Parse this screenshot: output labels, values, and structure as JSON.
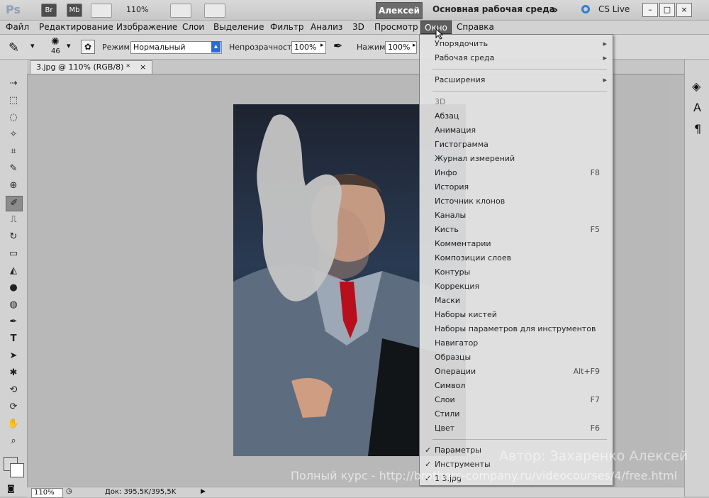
{
  "topbar": {
    "app_logo": "Ps",
    "br": "Br",
    "mb": "Mb",
    "zoom": "110%",
    "user": "Алексей",
    "workspace": "Основная рабочая среда",
    "cs_live": "CS Live"
  },
  "menubar": {
    "items": [
      "Файл",
      "Редактирование",
      "Изображение",
      "Слои",
      "Выделение",
      "Фильтр",
      "Анализ",
      "3D",
      "Просмотр",
      "Окно",
      "Справка"
    ]
  },
  "options": {
    "brush_size": "46",
    "mode_label": "Режим:",
    "mode_value": "Нормальный",
    "opacity_label": "Непрозрачность:",
    "opacity_value": "100%",
    "pressure_label": "Нажим:",
    "pressure_value": "100%"
  },
  "document": {
    "tab_title": "3.jpg @ 110% (RGB/8) *",
    "status_zoom": "110%",
    "doc_info": "Док: 395,5K/395,5K"
  },
  "dropdown": {
    "items": [
      {
        "label": "Упорядочить",
        "submenu": true
      },
      {
        "label": "Рабочая среда",
        "submenu": true
      },
      {
        "label": "Расширения",
        "submenu": true
      },
      {
        "label": "3D",
        "dim": true
      },
      {
        "label": "Абзац"
      },
      {
        "label": "Анимация"
      },
      {
        "label": "Гистограмма"
      },
      {
        "label": "Журнал измерений"
      },
      {
        "label": "Инфо",
        "shortcut": "F8"
      },
      {
        "label": "История"
      },
      {
        "label": "Источник клонов"
      },
      {
        "label": "Каналы"
      },
      {
        "label": "Кисть",
        "shortcut": "F5"
      },
      {
        "label": "Комментарии"
      },
      {
        "label": "Композиции слоев"
      },
      {
        "label": "Контуры"
      },
      {
        "label": "Коррекция"
      },
      {
        "label": "Маски"
      },
      {
        "label": "Наборы кистей"
      },
      {
        "label": "Наборы параметров для инструментов"
      },
      {
        "label": "Навигатор"
      },
      {
        "label": "Образцы"
      },
      {
        "label": "Операции",
        "shortcut": "Alt+F9"
      },
      {
        "label": "Символ"
      },
      {
        "label": "Слои",
        "shortcut": "F7"
      },
      {
        "label": "Стили"
      },
      {
        "label": "Цвет",
        "shortcut": "F6"
      },
      {
        "label": "Параметры",
        "checked": true
      },
      {
        "label": "Инструменты",
        "checked": true
      },
      {
        "label": "1 3.jpg",
        "checked": true
      }
    ]
  },
  "watermarks": {
    "author": "Автор: Захаренко Алексей",
    "course": "Полный курс - http://brothers-company.ru/videocourses/4/free.html"
  }
}
